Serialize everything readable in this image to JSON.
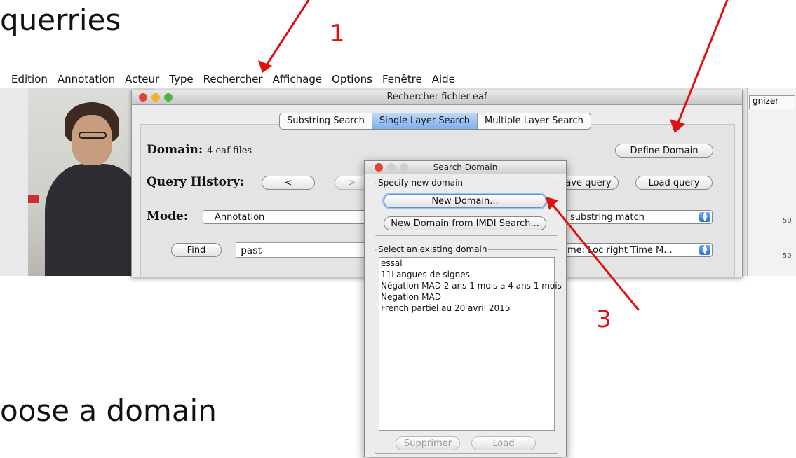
{
  "slide": {
    "title_fragment": "querries",
    "bottom_fragment": "oose a domain",
    "numbers": {
      "one": "1",
      "three": "3"
    }
  },
  "menubar": [
    "Edition",
    "Annotation",
    "Acteur",
    "Type",
    "Rechercher",
    "Affichage",
    "Options",
    "Fenêtre",
    "Aide"
  ],
  "right_panel": {
    "tab_label": "gnizer",
    "tick_1": "50",
    "tick_2": "50"
  },
  "search_window": {
    "title": "Rechercher fichier eaf",
    "tabs": [
      "Substring Search",
      "Single Layer Search",
      "Multiple Layer Search"
    ],
    "selected_tab": "Single Layer Search",
    "domain_label": "Domain:",
    "domain_value": "4 eaf files",
    "define_domain_button": "Define Domain",
    "query_history_label": "Query History:",
    "history_back": "<",
    "history_forward": ">",
    "save_query_button": "ave query",
    "load_query_button": "Load query",
    "mode_label": "Mode:",
    "mode_select": "Annotation",
    "match_select": "substring match",
    "find_button": "Find",
    "find_input": "past",
    "tier_select": "ame: Loc right Time M..."
  },
  "search_domain_dialog": {
    "title": "Search Domain",
    "specify_group_label": "Specify new domain",
    "new_domain_button": "New Domain...",
    "new_domain_imdi_button": "New Domain from IMDI Search...",
    "existing_group_label": "Select an existing domain",
    "domains": [
      "essai",
      "11Langues de signes",
      "Négation MAD 2 ans 1 mois a 4 ans 1 mois",
      "Negation MAD",
      "French partiel au 20 avril 2015"
    ],
    "delete_button": "Supprimer",
    "load_button": "Load"
  },
  "colors": {
    "annotation_arrow": "#e01010",
    "selected_tab": "#7fb0f0",
    "close_button": "#e0443e",
    "minimize_button": "#f0b429",
    "zoom_button": "#4fb34a"
  }
}
